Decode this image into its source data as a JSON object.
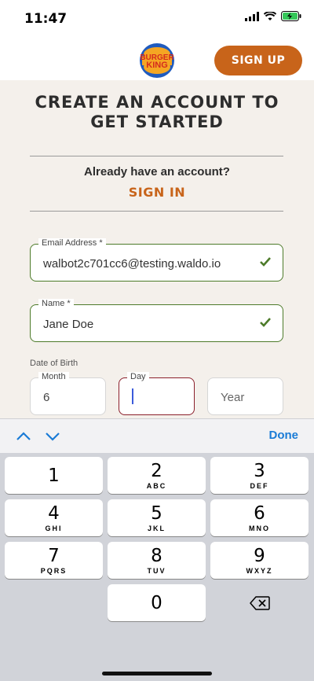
{
  "status": {
    "time": "11:47"
  },
  "header": {
    "brand_logo_text_1": "BURGER",
    "brand_logo_text_2": "KING",
    "signup_label": "SIGN UP"
  },
  "main": {
    "title": "CREATE AN ACCOUNT TO GET STARTED",
    "already_text": "Already have an account?",
    "signin_label": "SIGN IN",
    "email": {
      "label": "Email Address *",
      "value": "walbot2c701cc6@testing.waldo.io"
    },
    "name": {
      "label": "Name *",
      "value": "Jane Doe"
    },
    "dob_label": "Date of Birth",
    "month": {
      "label": "Month",
      "value": "6"
    },
    "day": {
      "label": "Day",
      "value": ""
    },
    "year": {
      "placeholder": "Year"
    }
  },
  "accessory": {
    "done_label": "Done"
  },
  "keyboard": {
    "keys": [
      {
        "num": "1",
        "letters": ""
      },
      {
        "num": "2",
        "letters": "ABC"
      },
      {
        "num": "3",
        "letters": "DEF"
      },
      {
        "num": "4",
        "letters": "GHI"
      },
      {
        "num": "5",
        "letters": "JKL"
      },
      {
        "num": "6",
        "letters": "MNO"
      },
      {
        "num": "7",
        "letters": "PQRS"
      },
      {
        "num": "8",
        "letters": "TUV"
      },
      {
        "num": "9",
        "letters": "WXYZ"
      },
      {
        "num": "0",
        "letters": ""
      }
    ]
  },
  "colors": {
    "accent": "#c8641a",
    "valid": "#4d7b2a",
    "active": "#8b1f2b",
    "link": "#1a7bd6"
  }
}
